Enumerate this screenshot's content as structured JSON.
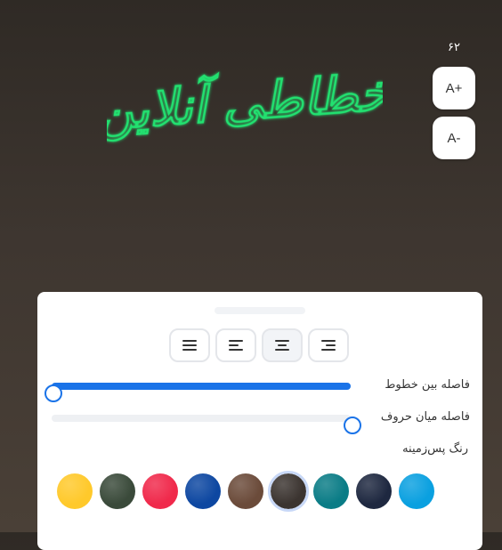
{
  "preview": {
    "text": "خطاطی آنلاین",
    "text_color": "#22e06f",
    "background": "#3b3430"
  },
  "font_size": {
    "value": "۶۲",
    "increase_label": "A+",
    "decrease_label": "A-"
  },
  "panel": {
    "alignment": {
      "options": [
        "justify",
        "left",
        "center",
        "right"
      ],
      "selected": "center"
    },
    "line_spacing": {
      "label": "فاصله بین خطوط",
      "value_fraction": 1.0
    },
    "letter_spacing": {
      "label": "فاصله میان حروف",
      "value_fraction": 1.0
    },
    "background_color": {
      "label": "رنگ پس‌زمینه",
      "swatches": [
        {
          "name": "yellow-swatch",
          "color": "#ffc92b"
        },
        {
          "name": "dark-green-swatch",
          "color": "#3a4a3a"
        },
        {
          "name": "red-swatch",
          "color": "#f0294b"
        },
        {
          "name": "navy-swatch",
          "color": "#0d47a1"
        },
        {
          "name": "brown-swatch",
          "color": "#6b4b3a"
        },
        {
          "name": "dark-brown-swatch",
          "color": "#3b3430",
          "selected": true
        },
        {
          "name": "teal-swatch",
          "color": "#0a7c86"
        },
        {
          "name": "midnight-swatch",
          "color": "#1e2840"
        },
        {
          "name": "blue-swatch",
          "color": "#0aa0e0"
        }
      ]
    }
  },
  "colors": {
    "accent": "#1a73e8"
  }
}
